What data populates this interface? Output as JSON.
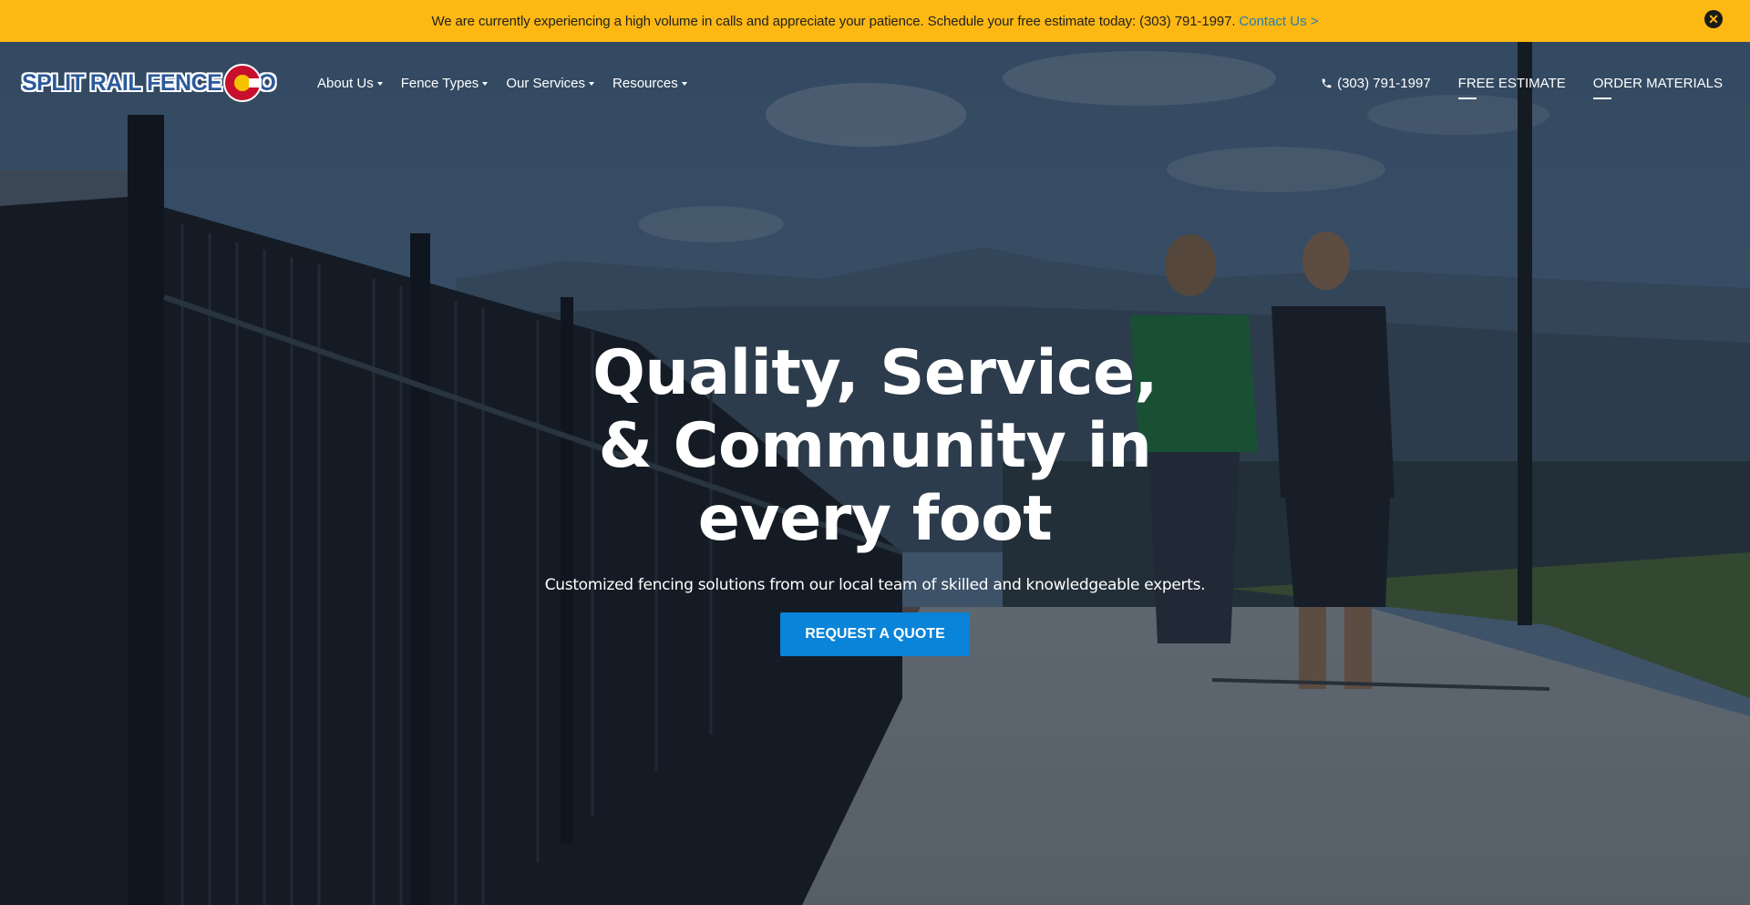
{
  "announcement": {
    "message": "We are currently experiencing a high volume in calls and appreciate your patience. Schedule your free estimate today: (303) 791-1997.",
    "link_label": "Contact Us >",
    "close_icon": "close-circle-icon"
  },
  "header": {
    "logo_text": "SPLIT RAIL FENCE",
    "logo_suffix": "O",
    "nav": [
      {
        "label": "About Us",
        "icon": "caret-down-icon"
      },
      {
        "label": "Fence Types",
        "icon": "caret-down-icon"
      },
      {
        "label": "Our Services",
        "icon": "caret-down-icon"
      },
      {
        "label": "Resources",
        "icon": "caret-down-icon"
      }
    ],
    "phone": {
      "label": "(303) 791-1997",
      "icon": "phone-icon"
    },
    "free_estimate": "FREE ESTIMATE",
    "order_materials": "ORDER MATERIALS"
  },
  "hero": {
    "headline_lines": [
      "Quality, Service,",
      "& Community in",
      "every foot"
    ],
    "subheadline": "Customized fencing solutions from our local team of skilled and knowledgeable experts.",
    "button_label": "REQUEST A QUOTE"
  },
  "colors": {
    "announcement_bg": "#fdb813",
    "link": "#1f7fb5",
    "button": "#0984d8",
    "text_light": "#ffffff"
  }
}
